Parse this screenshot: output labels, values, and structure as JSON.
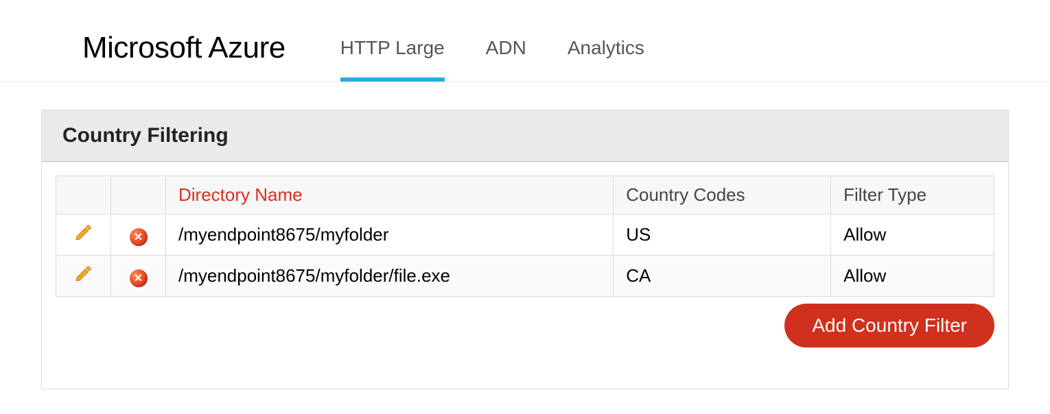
{
  "header": {
    "logo": "Microsoft Azure",
    "nav": [
      {
        "label": "HTTP Large",
        "active": true
      },
      {
        "label": "ADN",
        "active": false
      },
      {
        "label": "Analytics",
        "active": false
      }
    ]
  },
  "panel": {
    "title": "Country Filtering",
    "columns": {
      "edit": "",
      "delete": "",
      "directory_name": "Directory Name",
      "country_codes": "Country Codes",
      "filter_type": "Filter Type"
    },
    "rows": [
      {
        "directory_name": "/myendpoint8675/myfolder",
        "country_codes": "US",
        "filter_type": "Allow"
      },
      {
        "directory_name": "/myendpoint8675/myfolder/file.exe",
        "country_codes": "CA",
        "filter_type": "Allow"
      }
    ],
    "add_button_label": "Add Country Filter"
  },
  "icons": {
    "edit": "pencil-icon",
    "delete": "delete-icon"
  }
}
